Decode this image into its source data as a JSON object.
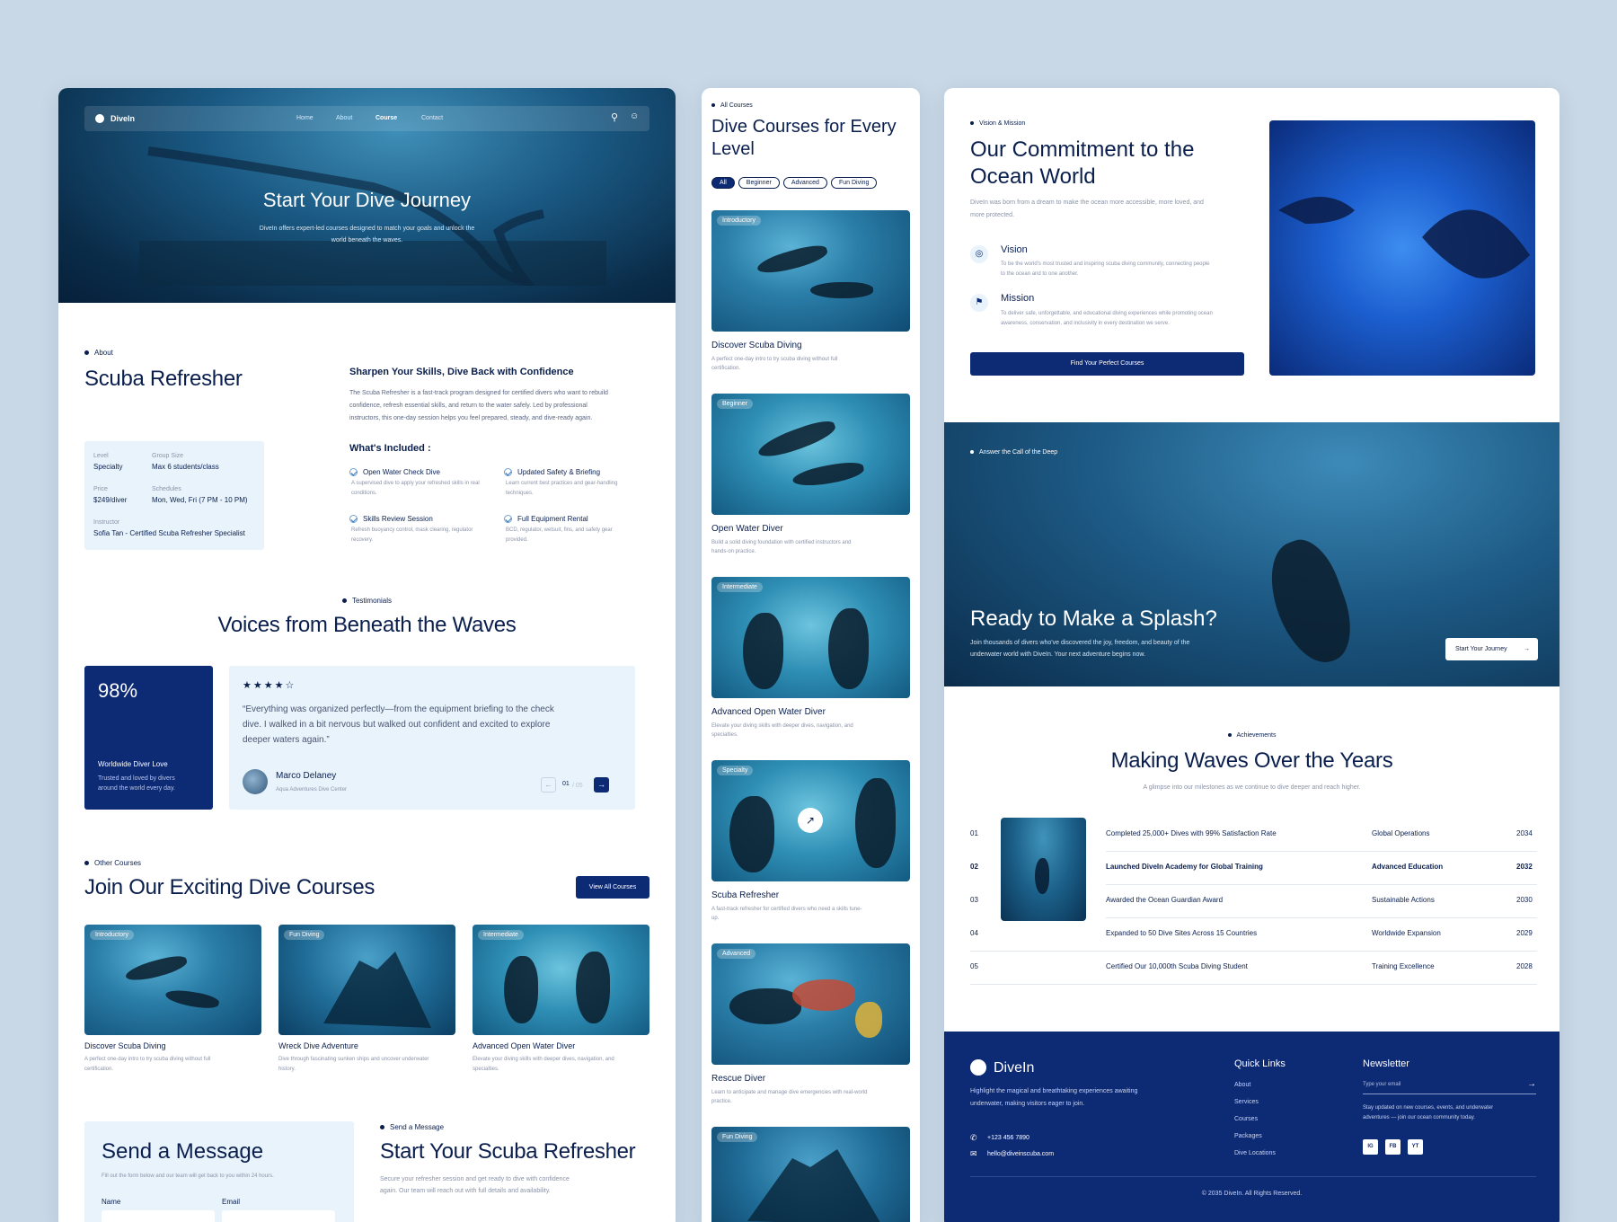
{
  "brand": "DiveIn",
  "p1": {
    "nav": {
      "links": [
        "Home",
        "About",
        "Course",
        "Contact"
      ]
    },
    "hero": {
      "title": "Start Your Dive Journey",
      "subtitle_1": "DiveIn offers expert-led courses designed to match your goals and unlock the",
      "subtitle_2": "world beneath the waves."
    },
    "about": {
      "eyebrow": "About",
      "title": "Scuba Refresher",
      "info": {
        "level_label": "Level",
        "level": "Specialty",
        "group_label": "Group Size",
        "group": "Max 6 students/class",
        "price_label": "Price",
        "price": "$249/diver",
        "schedule_label": "Schedules",
        "schedule": "Mon, Wed, Fri (7 PM - 10 PM)",
        "instructor_label": "Instructor",
        "instructor": "Sofia Tan - Certified Scuba Refresher Specialist"
      },
      "headline": "Sharpen Your Skills, Dive Back with Confidence",
      "body_1": "The Scuba Refresher is a fast-track program designed for certified divers who want to rebuild",
      "body_2": "confidence, refresh essential skills, and return to the water safely. Led by professional",
      "body_3": "instructors, this one-day session helps you feel prepared, steady, and dive-ready again.",
      "included_title": "What's Included :",
      "included": [
        {
          "title": "Open Water Check Dive",
          "desc_1": "A supervised dive to apply your refreshed skills in real",
          "desc_2": "conditions."
        },
        {
          "title": "Updated Safety & Briefing",
          "desc_1": "Learn current best practices and gear-handling",
          "desc_2": "techniques."
        },
        {
          "title": "Skills Review Session",
          "desc_1": "Refresh buoyancy control, mask clearing, regulator",
          "desc_2": "recovery."
        },
        {
          "title": "Full Equipment Rental",
          "desc_1": "BCD, regulator, wetsuit, fins, and safety gear",
          "desc_2": "provided."
        }
      ]
    },
    "testimonials": {
      "eyebrow": "Testimonials",
      "title": "Voices from Beneath the Waves",
      "stat": "98%",
      "stat_label": "Worldwide Diver Love",
      "stat_desc_1": "Trusted and loved by divers",
      "stat_desc_2": "around the world every day.",
      "rating": 4,
      "quote_1": "“Everything was organized perfectly—from the equipment briefing to the check",
      "quote_2": "dive. I walked in a bit nervous but walked out confident and excited to explore",
      "quote_3": "deeper waters again.”",
      "name": "Marco Delaney",
      "org": "Aqua Adventures Dive Center",
      "page": "01",
      "page_total": "/ 05"
    },
    "other": {
      "eyebrow": "Other Courses",
      "title": "Join Our Exciting Dive Courses",
      "button": "View All Courses",
      "cards": [
        {
          "tag": "Introductory",
          "title": "Discover Scuba Diving",
          "desc_1": "A perfect one-day intro to try scuba diving without full",
          "desc_2": "certification."
        },
        {
          "tag": "Fun Diving",
          "title": "Wreck Dive Adventure",
          "desc_1": "Dive through fascinating sunken ships and uncover underwater",
          "desc_2": "history."
        },
        {
          "tag": "Intermediate",
          "title": "Advanced Open Water Diver",
          "desc_1": "Elevate your diving skills with deeper dives, navigation, and",
          "desc_2": "specialties."
        }
      ]
    },
    "message": {
      "title": "Send a Message",
      "desc": "Fill out the form below and our team will get back to you within 24 hours.",
      "name_label": "Name",
      "email_label": "Email",
      "eyebrow": "Send a Message",
      "cta_title": "Start Your Scuba Refresher",
      "cta_desc_1": "Secure your refresher session and get ready to dive with confidence",
      "cta_desc_2": "again. Our team will reach out with full details and availability."
    }
  },
  "p2": {
    "eyebrow": "All Courses",
    "title_1": "Dive Courses for Every",
    "title_2": "Level",
    "filters": [
      "All",
      "Beginner",
      "Advanced",
      "Fun Diving"
    ],
    "courses": [
      {
        "tag": "Introductory",
        "title": "Discover Scuba Diving",
        "desc_1": "A perfect one-day intro to try scuba diving without full",
        "desc_2": "certification."
      },
      {
        "tag": "Beginner",
        "title": "Open Water Diver",
        "desc_1": "Build a solid diving foundation with certified instructors and",
        "desc_2": "hands-on practice."
      },
      {
        "tag": "Intermediate",
        "title": "Advanced Open Water Diver",
        "desc_1": "Elevate your diving skills with deeper dives, navigation, and",
        "desc_2": "specialties."
      },
      {
        "tag": "Specialty",
        "title": "Scuba Refresher",
        "desc_1": "A fast-track refresher for certified divers who need a skills tune-",
        "desc_2": "up."
      },
      {
        "tag": "Advanced",
        "title": "Rescue Diver",
        "desc_1": "Learn to anticipate and manage dive emergencies with real-world",
        "desc_2": "practice."
      },
      {
        "tag": "Fun Diving",
        "title": "",
        "desc_1": "",
        "desc_2": ""
      }
    ]
  },
  "p3": {
    "vm": {
      "eyebrow": "Vision & Mission",
      "title_1": "Our Commitment to the",
      "title_2": "Ocean World",
      "desc_1": "DiveIn was born from a dream to make the ocean more accessible, more loved, and",
      "desc_2": "more protected.",
      "vision_title": "Vision",
      "vision_desc_1": "To be the world's most trusted and inspiring scuba diving community, connecting people",
      "vision_desc_2": "to the ocean and to one another.",
      "mission_title": "Mission",
      "mission_desc_1": "To deliver safe, unforgettable, and educational diving experiences while promoting ocean",
      "mission_desc_2": "awareness, conservation, and inclusivity in every destination we serve.",
      "button": "Find Your Perfect Courses"
    },
    "cta": {
      "eyebrow": "Answer the Call of the Deep",
      "title": "Ready to Make a Splash?",
      "desc_1": "Join thousands of divers who've discovered the joy, freedom, and beauty of the",
      "desc_2": "underwater world with DiveIn. Your next adventure begins now.",
      "button": "Start Your Journey"
    },
    "achievements": {
      "eyebrow": "Achievements",
      "title": "Making Waves Over the Years",
      "subtitle": "A glimpse into our milestones as we continue to dive deeper and reach higher.",
      "rows": [
        {
          "num": "01",
          "title": "Completed 25,000+ Dives with 99% Satisfaction Rate",
          "category": "Global Operations",
          "year": "2034"
        },
        {
          "num": "02",
          "title": "Launched DiveIn Academy for Global Training",
          "category": "Advanced Education",
          "year": "2032"
        },
        {
          "num": "03",
          "title": "Awarded the Ocean Guardian Award",
          "category": "Sustainable Actions",
          "year": "2030"
        },
        {
          "num": "04",
          "title": "Expanded to 50 Dive Sites Across 15 Countries",
          "category": "Worldwide Expansion",
          "year": "2029"
        },
        {
          "num": "05",
          "title": "Certified Our 10,000th Scuba Diving Student",
          "category": "Training Excellence",
          "year": "2028"
        }
      ]
    },
    "footer": {
      "desc_1": "Highlight the magical and breathtaking experiences awaiting",
      "desc_2": "underwater, making visitors eager to join.",
      "phone": "+123 456 7890",
      "email": "hello@diveinscuba.com",
      "links_title": "Quick Links",
      "links": [
        "About",
        "Services",
        "Courses",
        "Packages",
        "Dive Locations"
      ],
      "newsletter_title": "Newsletter",
      "newsletter_placeholder": "Type your email",
      "newsletter_desc_1": "Stay updated on new courses, events, and underwater",
      "newsletter_desc_2": "adventures — join our ocean community today.",
      "socials": [
        "IG",
        "FB",
        "YT"
      ],
      "copyright": "© 2035 DiveIn. All Rights Reserved."
    }
  },
  "colors": {
    "navy": "#0d2a75",
    "light_panel": "#e8f3fc",
    "background": "#c8d8e6"
  }
}
